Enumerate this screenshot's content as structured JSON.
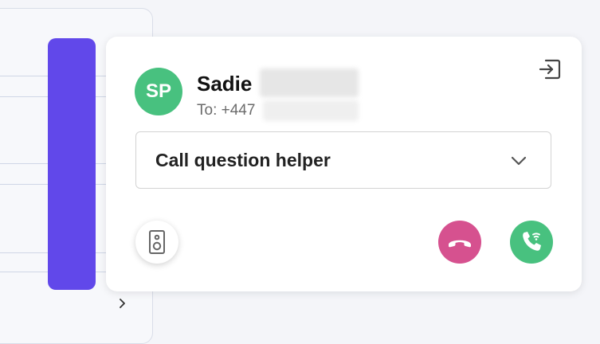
{
  "caller": {
    "initials": "SP",
    "name": "Sadie",
    "to_prefix": "To: +447"
  },
  "question_select": {
    "selected": "Call question helper"
  },
  "icons": {
    "exit": "exit-icon",
    "dropdown": "chevron-down-icon",
    "speaker": "speaker-icon",
    "hangup": "phone-hangup-icon",
    "answer": "phone-wifi-icon",
    "background_nav": "chevron-right-icon"
  },
  "colors": {
    "avatar": "#48c17f",
    "purple_bar": "#6148ea",
    "hangup": "#d6518f",
    "answer": "#48c17f"
  }
}
